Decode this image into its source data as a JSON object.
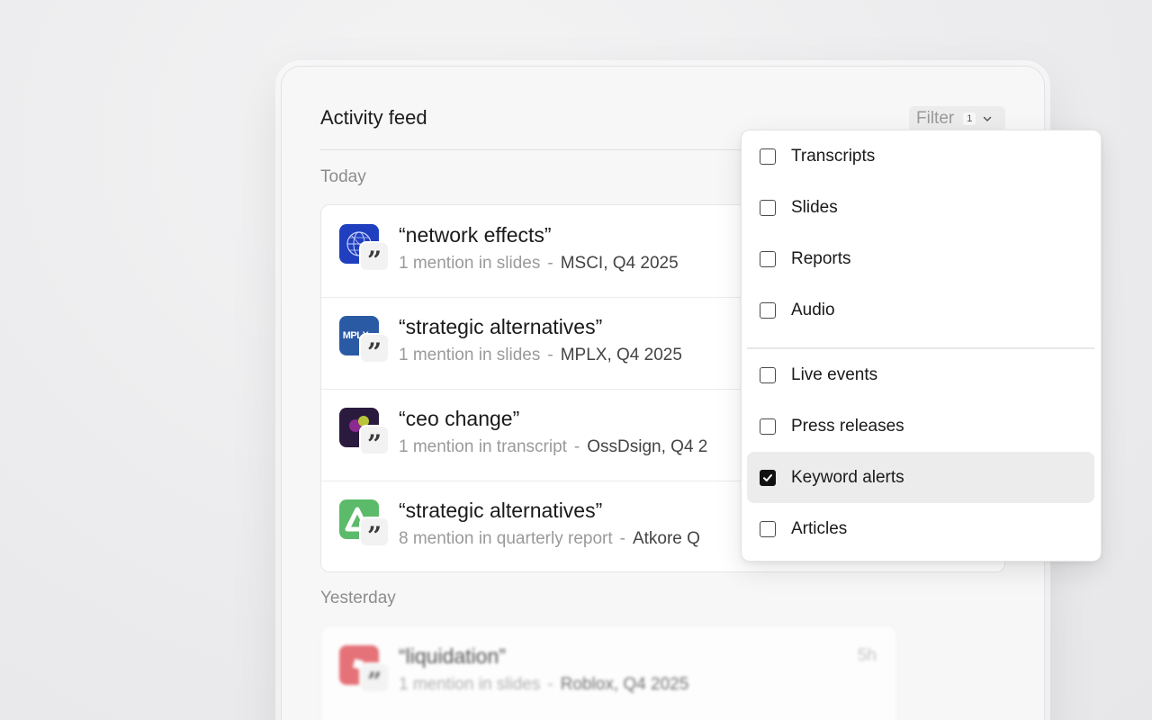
{
  "panel": {
    "title": "Activity feed",
    "filter": {
      "label": "Filter",
      "count": "1"
    }
  },
  "sections": {
    "today": "Today",
    "yesterday": "Yesterday"
  },
  "today_items": [
    {
      "title": "“network effects”",
      "mention": "1 mention in slides",
      "sep": "-",
      "source": "MSCI, Q4 2025",
      "logo": "msci-globe-logo"
    },
    {
      "title": "“strategic alternatives”",
      "mention": "1 mention in slides",
      "sep": "-",
      "source": "MPLX, Q4 2025",
      "logo": "mplx-logo",
      "logo_text": "MPLX"
    },
    {
      "title": "“ceo change”",
      "mention": "1 mention in transcript",
      "sep": "-",
      "source": "OssDsign, Q4 2",
      "logo": "ossdsign-logo"
    },
    {
      "title": "“strategic alternatives”",
      "mention": "8 mention in quarterly report",
      "sep": "-",
      "source": "Atkore Q",
      "logo": "atkore-logo"
    }
  ],
  "yesterday_items": [
    {
      "title": "“liquidation”",
      "mention": "1 mention in slides",
      "sep": "-",
      "source": "Roblox, Q4 2025",
      "time": "5h",
      "logo": "roblox-logo"
    }
  ],
  "filter_options": {
    "group1": [
      {
        "label": "Transcripts",
        "checked": false
      },
      {
        "label": "Slides",
        "checked": false
      },
      {
        "label": "Reports",
        "checked": false
      },
      {
        "label": "Audio",
        "checked": false
      }
    ],
    "group2": [
      {
        "label": "Live events",
        "checked": false
      },
      {
        "label": "Press releases",
        "checked": false
      },
      {
        "label": "Keyword alerts",
        "checked": true
      },
      {
        "label": "Articles",
        "checked": false
      }
    ]
  },
  "colors": {
    "msci": "#1f3fbf",
    "mplx": "#2b5aa5",
    "ossdsign": "#2a1a3d",
    "atkore": "#5cbb6a",
    "roblox": "#e0464e",
    "checked": "#111111"
  }
}
